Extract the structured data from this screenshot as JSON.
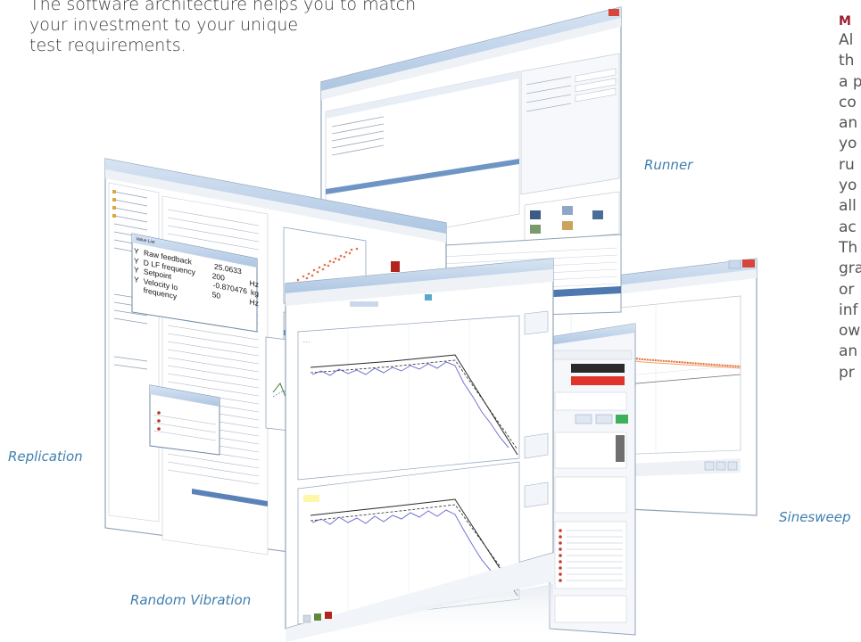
{
  "intro": {
    "line1": "The software architecture helps you to match",
    "line2": "your investment to your unique",
    "line3": "test requirements."
  },
  "sidebar": {
    "heading": "M",
    "lines": [
      "Al",
      "th",
      "a p",
      "co",
      "an",
      "yo",
      "ru",
      "yo",
      "all",
      "ac",
      "Th",
      "gra",
      "or",
      "inf",
      "ow",
      "an",
      "pr"
    ]
  },
  "captions": {
    "runner": "Runner",
    "replication": "Replication",
    "random_vibration": "Random Vibration",
    "sinesweep": "Sinesweep"
  },
  "replication_panel": {
    "rows": [
      {
        "channel": "Y",
        "label": "Raw feedback",
        "value": "25.0633",
        "unit": ""
      },
      {
        "channel": "Y",
        "label": "D LF frequency",
        "value": "200",
        "unit": "Hz"
      },
      {
        "channel": "Y",
        "label": "Setpoint",
        "value": "-0.870476",
        "unit": "kg"
      },
      {
        "channel": "Y",
        "label": "Velocity lo frequency",
        "value": "50",
        "unit": "Hz"
      }
    ]
  },
  "colors": {
    "accent_red": "#9b1d30",
    "caption_blue": "#3f7fb0",
    "body_text": "#3a3a3a"
  },
  "icons": [
    "window-close-icon",
    "window-maximize-icon",
    "window-minimize-icon"
  ]
}
